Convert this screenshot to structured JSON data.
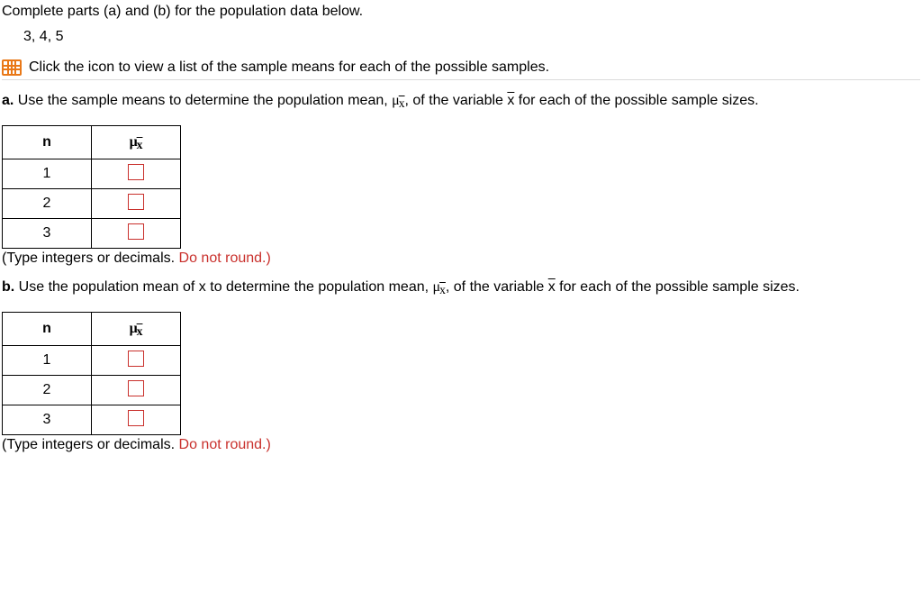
{
  "intro": {
    "line1": "Complete parts (a) and (b) for the population data below.",
    "data_values": "3, 4, 5",
    "icon_text": "Click the icon to view a list of the sample means for each of the possible samples."
  },
  "symbols": {
    "mu_xbar_html": "μ",
    "xbar_sub": "x",
    "xbar": "x"
  },
  "part_a": {
    "label": "a.",
    "text_before_mu": " Use the sample means to determine the population mean, ",
    "text_after_mu": ", of the variable ",
    "text_after_xbar": " for each of the possible sample sizes.",
    "table": {
      "header_n": "n",
      "header_mu_main": "μ",
      "header_mu_sub": "x",
      "rows": [
        "1",
        "2",
        "3"
      ]
    },
    "hint_black": "(Type integers or decimals.",
    "hint_red": " Do not round.)"
  },
  "part_b": {
    "label": "b.",
    "text_before_mu": " Use the population mean of x to determine the population mean, ",
    "text_after_mu": ", of the variable ",
    "text_after_xbar": " for each of the possible sample sizes.",
    "table": {
      "header_n": "n",
      "header_mu_main": "μ",
      "header_mu_sub": "x",
      "rows": [
        "1",
        "2",
        "3"
      ]
    },
    "hint_black": "(Type integers or decimals.",
    "hint_red": " Do not round.)"
  }
}
